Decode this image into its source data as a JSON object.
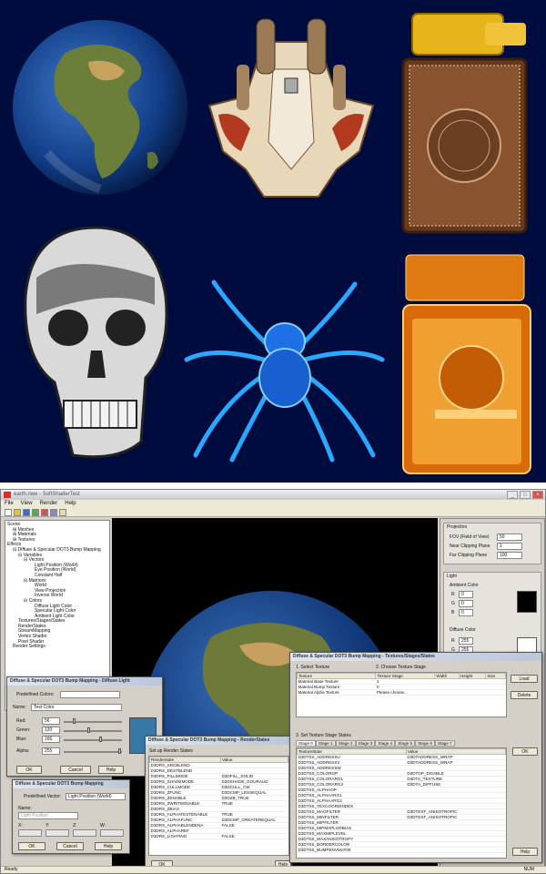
{
  "gallery": {
    "items": [
      "earth",
      "spaceship",
      "lighter-gold",
      "skull",
      "spider",
      "lighter-orange"
    ]
  },
  "app": {
    "title": "earth.nwe - SoftShaderTest",
    "menu": [
      "File",
      "View",
      "Render",
      "Help"
    ],
    "tree": [
      "Scene",
      "Meshes",
      "Materials",
      "Textures",
      "Effects",
      "Diffuse & Specular DOT3 Bump Mapping",
      "Variables",
      "Vectors",
      "Light Position (World)",
      "Eye Position (World)",
      "Constant Half",
      "Matrices",
      "World",
      "View Projection",
      "Inverse World",
      "Colors",
      "Diffuse Light Color",
      "Specular Light Color",
      "Ambient Light Color",
      "Textures/Stages/States",
      "RenderStates",
      "StreamMapping",
      "Vertex Shader",
      "Pixel Shader",
      "Render Settings"
    ],
    "projection": {
      "title": "Projection",
      "fov_label": "FOV (Field of View)",
      "fov": "50",
      "near_label": "Near Clipping Plane",
      "near": "1",
      "far_label": "Far Clipping Plane",
      "far": "100"
    },
    "light": {
      "title": "Light",
      "ambient": "Ambient Color",
      "diffuse": "Diffuse Color",
      "r": "R",
      "g": "G",
      "b": "B",
      "amb_vals": [
        "0",
        "0",
        "0"
      ],
      "dif_vals": [
        "255",
        "255",
        "255"
      ]
    },
    "status": "Ready",
    "num": "NUM"
  },
  "dlg_light": {
    "title": "Diffuse & Specular DOT3 Bump Mapping - Diffuse Light",
    "predef": "Predefined Colors:",
    "name_label": "Name:",
    "name": "Test Color",
    "red": "Red:",
    "green": "Green:",
    "blue": "Blue:",
    "alpha": "Alpha:",
    "vals": [
      "56",
      "120",
      "166",
      "255"
    ],
    "ok": "OK",
    "cancel": "Cancel",
    "help": "Help"
  },
  "dlg_vec": {
    "title": "Diffuse & Specular DOT3 Bump Mapping",
    "predef": "Predefined Vector:",
    "predef_val": "Light Position (World)",
    "name_label": "Name:",
    "name": "Light Position",
    "x": "X:",
    "y": "Y:",
    "z": "Z:",
    "w": "W:",
    "ok": "OK",
    "cancel": "Cancel",
    "help": "Help"
  },
  "dlg_rs": {
    "title": "Diffuse & Specular DOT3 Bump Mapping - RenderStates",
    "group": "Set up Render States",
    "cols": [
      "Renderstate",
      "Value"
    ],
    "rows": [
      [
        "D3DRS_SRCBLEND",
        ""
      ],
      [
        "D3DRS_DESTBLEND",
        ""
      ],
      [
        "D3DRS_FILLMODE",
        "D3DFILL_SOLID"
      ],
      [
        "D3DRS_SHADEMODE",
        "D3DSHADE_GOURAUD"
      ],
      [
        "D3DRS_CULLMODE",
        "D3DCULL_CW"
      ],
      [
        "D3DRS_ZFUNC",
        "D3DCMP_LESSEQUAL"
      ],
      [
        "D3DRS_ZENABLE",
        "D3DZB_TRUE"
      ],
      [
        "D3DRS_ZWRITEENABLE",
        "TRUE"
      ],
      [
        "D3DRS_ZBIAS",
        ""
      ],
      [
        "D3DRS_ALPHATESTENABLE",
        "TRUE"
      ],
      [
        "D3DRS_ALPHAFUNC",
        "D3DCMP_GREATEREQUAL"
      ],
      [
        "D3DRS_ALPHABLENDENA",
        "FALSE"
      ],
      [
        "D3DRS_ALPHAREF",
        ""
      ],
      [
        "D3DRS_LIGHTING",
        "FALSE"
      ]
    ],
    "ok": "OK",
    "help": "Help"
  },
  "dlg_tex": {
    "title": "Diffuse & Specular DOT3 Bump Mapping - Textures/Stages/States",
    "sec1": "1. Select Texture",
    "sec2": "2. Choose Texture Stage",
    "cols": [
      "Texture",
      "Texture Stage",
      "Width",
      "Height",
      "Size"
    ],
    "rows": [
      [
        "Material Base Texture",
        "1",
        "",
        "",
        ""
      ],
      [
        "Material Bump Texture",
        "0",
        "",
        "",
        ""
      ],
      [
        "Material Alpha Texture",
        "Please choose...",
        "",
        "",
        ""
      ]
    ],
    "load": "Load",
    "delete": "Delete",
    "sec3": "3. Set Texture Stage States",
    "tabs": [
      "Stage 0",
      "Stage 1",
      "Stage 2",
      "Stage 3",
      "Stage 4",
      "Stage 5",
      "Stage 6",
      "Stage 7"
    ],
    "scols": [
      "TextureState",
      "Value"
    ],
    "srows": [
      [
        "D3DTSS_ADDRESSU",
        "D3DTADDRESS_WRAP"
      ],
      [
        "D3DTSS_ADDRESSV",
        "D3DTADDRESS_WRAP"
      ],
      [
        "D3DTSS_ADDRESSW",
        ""
      ],
      [
        "D3DTSS_COLOROP",
        "D3DTOP_DISABLE"
      ],
      [
        "D3DTSS_COLORARG1",
        "D3DTA_TEXTURE"
      ],
      [
        "D3DTSS_COLORARG2",
        "D3DTA_DIFFUSE"
      ],
      [
        "D3DTSS_ALPHAOP",
        ""
      ],
      [
        "D3DTSS_ALPHAARG1",
        ""
      ],
      [
        "D3DTSS_ALPHAARG2",
        ""
      ],
      [
        "D3DTSS_TEXCOORDINDEX",
        ""
      ],
      [
        "D3DTSS_MAGFILTER",
        "D3DTEXF_ANISOTROPIC"
      ],
      [
        "D3DTSS_MINFILTER",
        "D3DTEXF_ANISOTROPIC"
      ],
      [
        "D3DTSS_MIPFILTER",
        ""
      ],
      [
        "D3DTSS_MIPMAPLODBIAS",
        ""
      ],
      [
        "D3DTSS_MAXMIPLEVEL",
        ""
      ],
      [
        "D3DTSS_MAXANISOTROPY",
        ""
      ],
      [
        "D3DTSS_BORDERCOLOR",
        ""
      ],
      [
        "D3DTSS_BUMPENVMAT00",
        ""
      ]
    ],
    "ok": "OK",
    "help": "Help"
  }
}
